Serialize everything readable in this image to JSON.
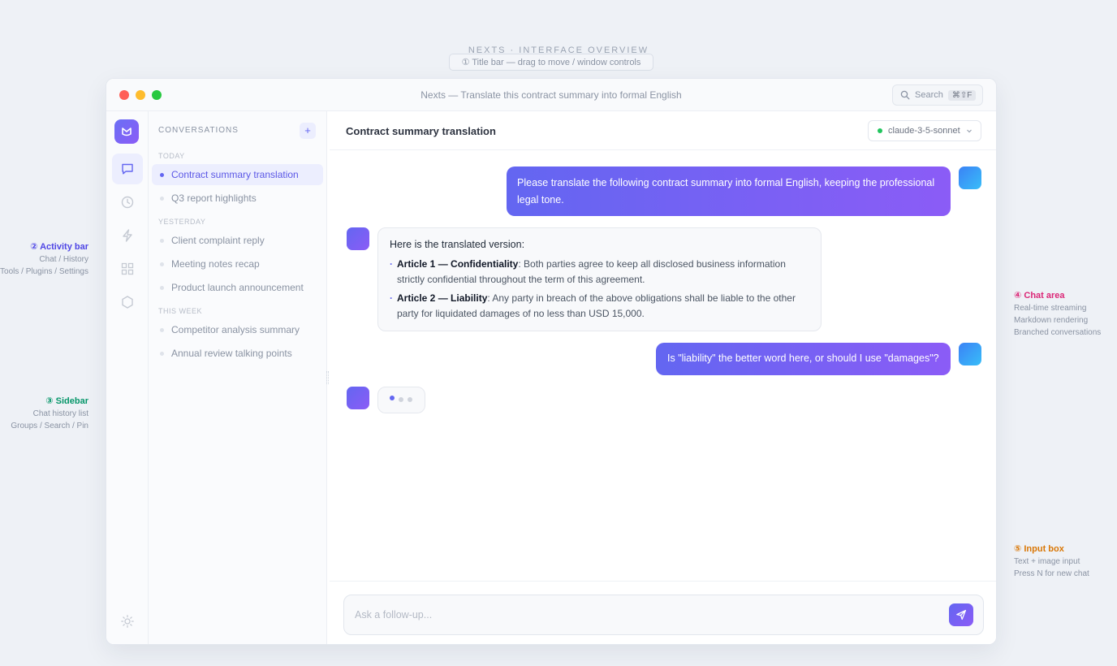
{
  "overview": {
    "title": "NEXTS · INTERFACE OVERVIEW",
    "titlebar_callout": "① Title bar — drag to move / window controls"
  },
  "annotations": {
    "activity_bar": {
      "title": "② Activity bar",
      "line1": "Chat / History",
      "line2": "Tools / Plugins / Settings",
      "color": "#4f46e5"
    },
    "sidebar": {
      "title": "③ Sidebar",
      "line1": "Chat history list",
      "line2": "Groups / Search / Pin",
      "color": "#059669"
    },
    "chat_area": {
      "title": "④ Chat area",
      "line1": "Real-time streaming",
      "line2": "Markdown rendering",
      "line3": "Branched conversations",
      "color": "#db2777"
    },
    "input_box": {
      "title": "⑤ Input box",
      "line1": "Text + image input",
      "line2": "Press N for new chat",
      "color": "#d97706"
    }
  },
  "window": {
    "title": "Nexts — Translate this contract summary into formal English",
    "search_label": "Search",
    "search_shortcut": "⌘⇧F"
  },
  "activity_bar": {
    "items": [
      "logo-icon",
      "chat-icon",
      "history-icon",
      "bolt-icon",
      "grid-icon",
      "hexagon-icon",
      "sun-icon"
    ],
    "active": "chat-icon"
  },
  "sidebar": {
    "header": "CONVERSATIONS",
    "add_label": "+",
    "groups": [
      {
        "label": "TODAY",
        "items": [
          "Contract summary translation",
          "Q3 report highlights"
        ]
      },
      {
        "label": "YESTERDAY",
        "items": [
          "Client complaint reply",
          "Meeting notes recap",
          "Product launch announcement"
        ]
      },
      {
        "label": "THIS WEEK",
        "items": [
          "Competitor analysis summary",
          "Annual review talking points"
        ]
      }
    ],
    "active_item": "Contract summary translation"
  },
  "chat": {
    "title": "Contract summary translation",
    "model": "claude-3-5-sonnet",
    "messages": [
      {
        "role": "user",
        "text": "Please translate the following contract summary into formal English, keeping the professional legal tone."
      },
      {
        "role": "assistant",
        "intro": "Here is the translated version:",
        "bullets": [
          {
            "bold": "Article 1 — Confidentiality",
            "text": ": Both parties agree to keep all disclosed business information strictly confidential throughout the term of this agreement."
          },
          {
            "bold": "Article 2 — Liability",
            "text": ": Any party in breach of the above obligations shall be liable to the other party for liquidated damages of no less than USD 15,000."
          }
        ]
      },
      {
        "role": "user",
        "text": "Is \"liability\" the better word here, or should I use \"damages\"?"
      },
      {
        "role": "assistant",
        "typing": true
      }
    ],
    "input_placeholder": "Ask a follow-up..."
  }
}
